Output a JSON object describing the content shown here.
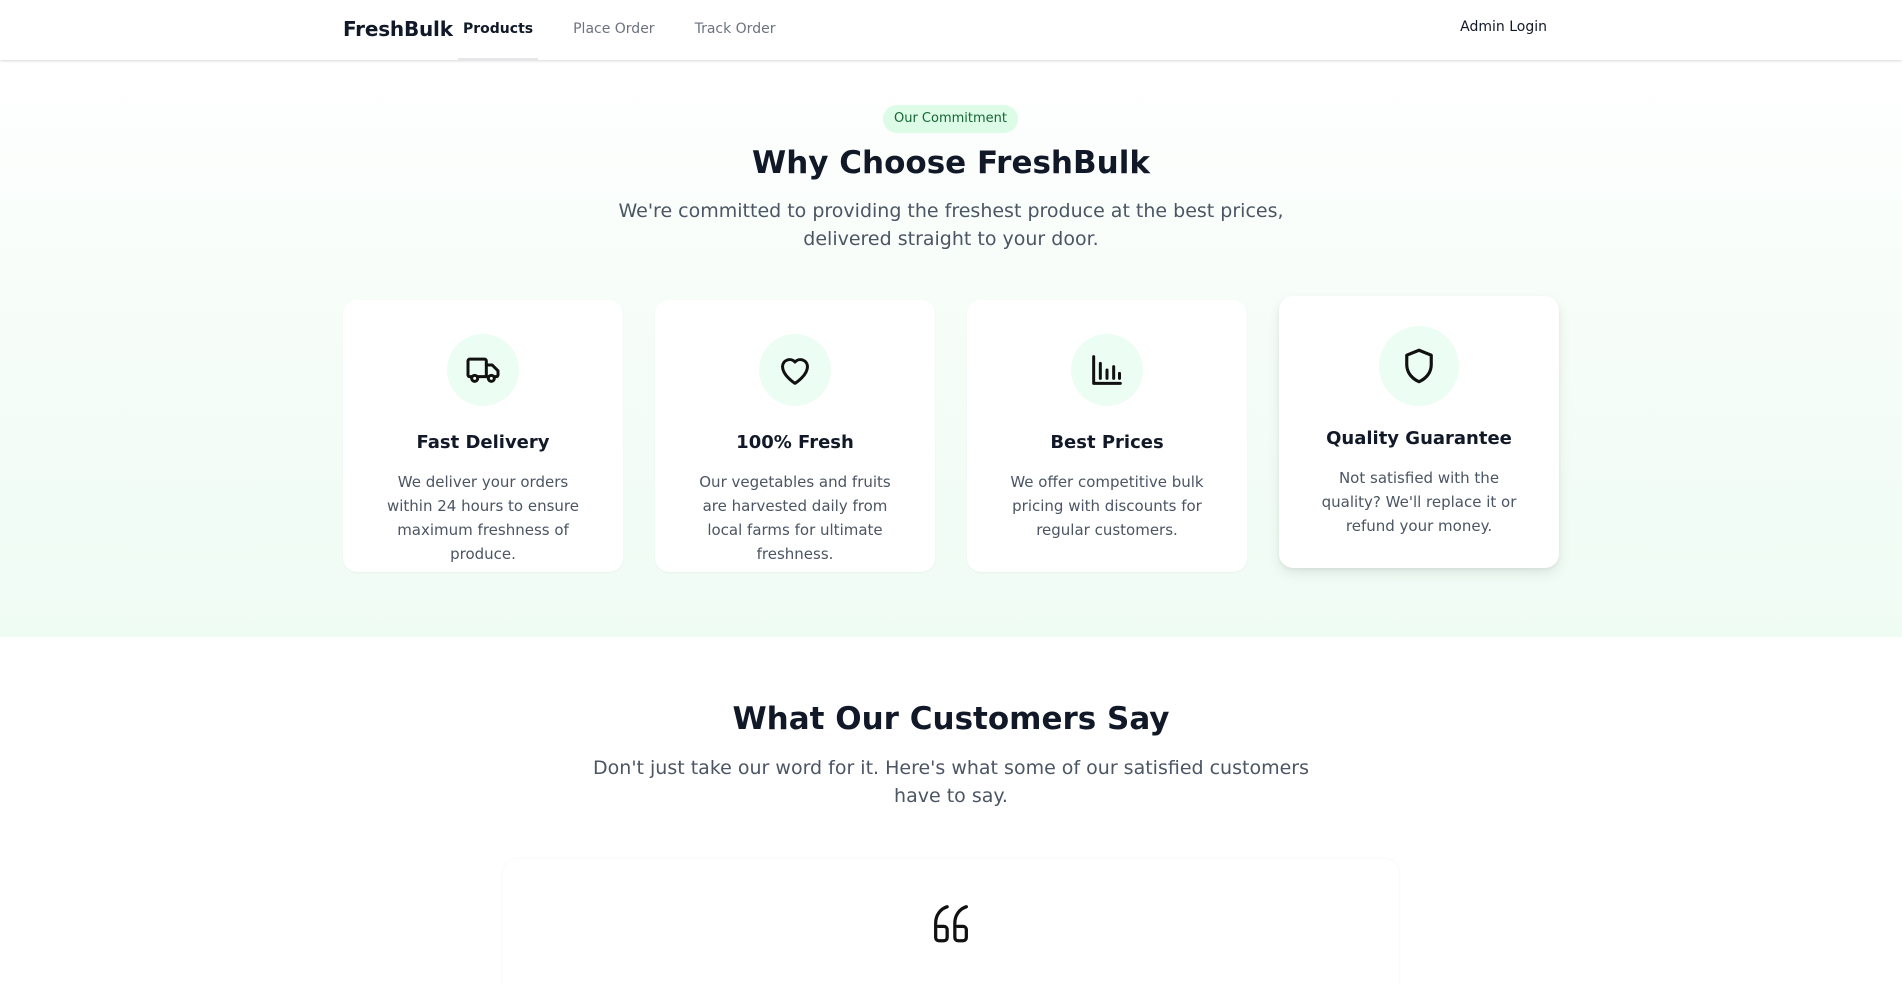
{
  "header": {
    "brand": "FreshBulk",
    "nav": [
      {
        "label": "Products",
        "active": true
      },
      {
        "label": "Place Order",
        "active": false
      },
      {
        "label": "Track Order",
        "active": false
      }
    ],
    "admin_login": "Admin Login"
  },
  "commitment": {
    "badge": "Our Commitment",
    "title": "Why Choose FreshBulk",
    "subtitle": "We're committed to providing the freshest produce at the best prices, delivered straight to your door.",
    "features": [
      {
        "icon": "truck-icon",
        "title": "Fast Delivery",
        "description": "We deliver your orders within 24 hours to ensure maximum freshness of produce."
      },
      {
        "icon": "heart-icon",
        "title": "100% Fresh",
        "description": "Our vegetables and fruits are harvested daily from local farms for ultimate freshness."
      },
      {
        "icon": "bar-chart-icon",
        "title": "Best Prices",
        "description": "We offer competitive bulk pricing with discounts for regular customers."
      },
      {
        "icon": "shield-icon",
        "title": "Quality Guarantee",
        "description": "Not satisfied with the quality? We'll replace it or refund your money."
      }
    ]
  },
  "testimonials": {
    "title": "What Our Customers Say",
    "subtitle": "Don't just take our word for it. Here's what some of our satisfied customers have to say.",
    "quote_icon": "quote-icon"
  },
  "colors": {
    "accent_bg": "#dcfce7",
    "accent_text": "#166534",
    "icon_circle": "#ecfdf3",
    "heading": "#111827",
    "body_text": "#4b5563"
  }
}
